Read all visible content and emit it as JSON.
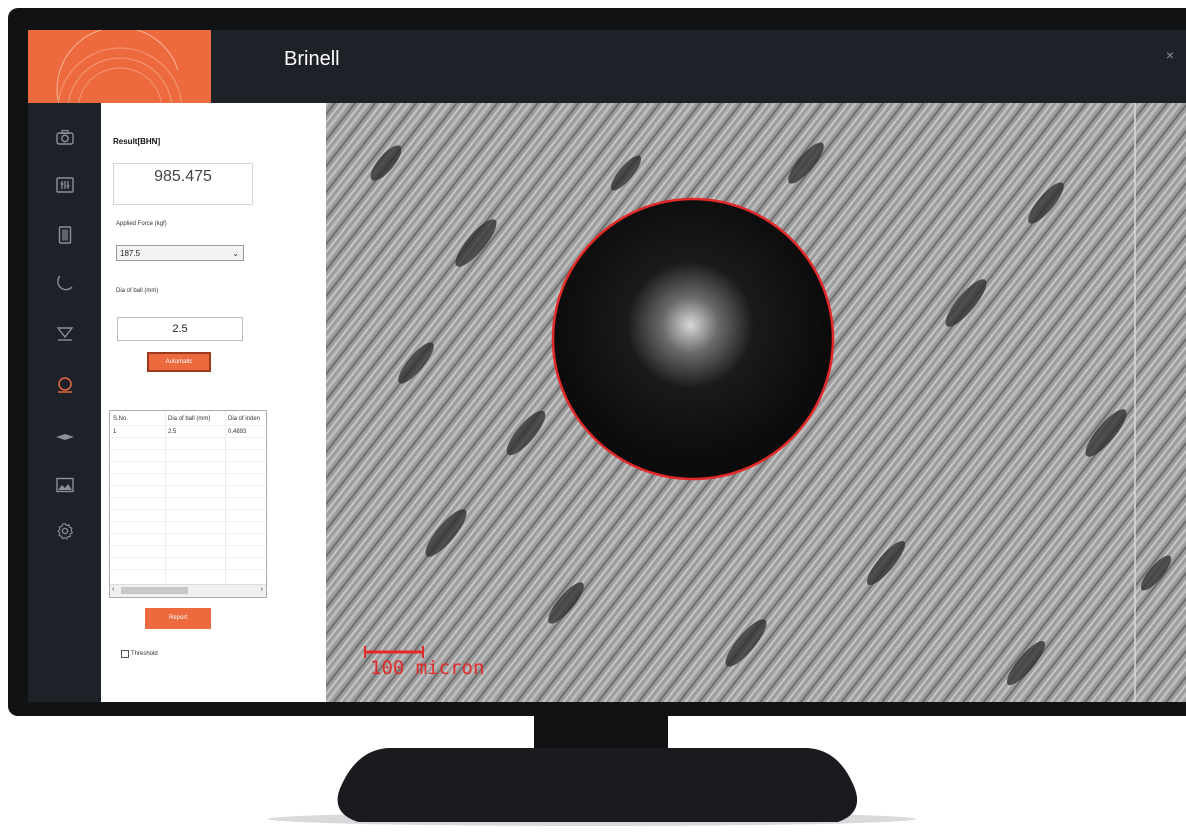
{
  "window": {
    "title": "Brinell",
    "close_glyph": "×"
  },
  "sidebar": {
    "items": [
      {
        "icon": "camera-icon"
      },
      {
        "icon": "adjustments-icon"
      },
      {
        "icon": "document-icon"
      },
      {
        "icon": "moon-icon"
      },
      {
        "icon": "vickers-icon"
      },
      {
        "icon": "brinell-icon",
        "active": true
      },
      {
        "icon": "knoop-icon"
      },
      {
        "icon": "image-icon"
      },
      {
        "icon": "settings-icon"
      }
    ]
  },
  "panel": {
    "result_label": "Result[BHN]",
    "result_value": "985.475",
    "force_label": "Applied Force (kgf)",
    "force_value": "187.5",
    "ball_label": "Dia of ball (mm)",
    "ball_value": "2.5",
    "automatic_label": "Automatic",
    "table": {
      "headers": [
        "S.No.",
        "Dia of ball (mm)",
        "Dia of inden"
      ],
      "rows": [
        [
          "1",
          "2.5",
          "0.4893"
        ]
      ]
    },
    "report_label": "Report",
    "threshold_label": "Threshold"
  },
  "image": {
    "scale_label": "100 micron"
  },
  "colors": {
    "accent": "#ec6a3e",
    "overlay": "#e32a2a",
    "chrome": "#1f2128"
  }
}
